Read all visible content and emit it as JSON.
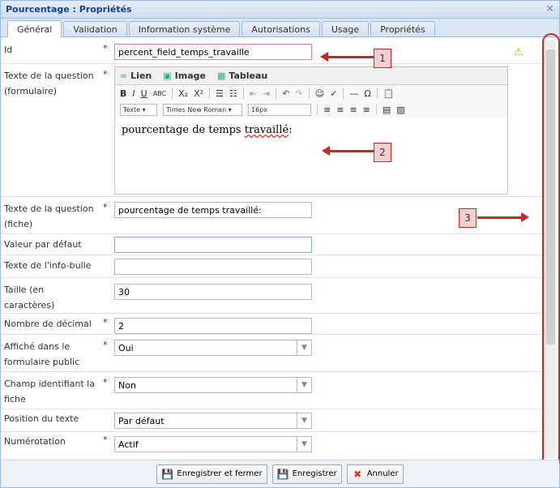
{
  "window": {
    "title": "Pourcentage : Propriétés",
    "close_icon": "close-icon"
  },
  "tabs": [
    {
      "label": "Général"
    },
    {
      "label": "Validation"
    },
    {
      "label": "Information système"
    },
    {
      "label": "Autorisations"
    },
    {
      "label": "Usage"
    },
    {
      "label": "Propriétés"
    }
  ],
  "fields": {
    "id": {
      "label": "Id",
      "required": "*",
      "value": "percent_field_temps_travaille"
    },
    "question_form": {
      "label": "Texte de la question (formulaire)",
      "required": "*"
    },
    "question_sheet": {
      "label": "Texte de la question (fiche)",
      "required": "*",
      "value": "pourcentage de temps travaillé:"
    },
    "default_value": {
      "label": "Valeur par défaut",
      "value": ""
    },
    "tooltip": {
      "label": "Texte de l'info-bulle",
      "value": ""
    },
    "size": {
      "label": "Taille (en caractères)",
      "value": "30"
    },
    "decimals": {
      "label": "Nombre de décimal",
      "required": "*",
      "value": "2"
    },
    "public_form": {
      "label": "Affiché dans le formulaire public",
      "required": "*",
      "value": "Oui"
    },
    "identifier": {
      "label": "Champ identifiant la fiche",
      "required": "*",
      "value": "Non"
    },
    "text_position": {
      "label": "Position du texte",
      "value": "Par défaut"
    },
    "numbering": {
      "label": "Numérotation",
      "required": "*",
      "value": "Actif"
    }
  },
  "editor": {
    "tabs": [
      "Lien",
      "Image",
      "Tableau"
    ],
    "style_select": "Texte",
    "font_select": "Times New Roman",
    "size_select": "16px",
    "content_prefix": "pourcentage de temps ",
    "content_squiggle": "travaillé",
    "content_suffix": ":"
  },
  "callouts": [
    "1",
    "2",
    "3"
  ],
  "buttons": {
    "save_close": "Enregistrer et fermer",
    "save": "Enregistrer",
    "cancel": "Annuler"
  },
  "colors": {
    "accent": "#15428b",
    "annotation": "#c62828"
  }
}
